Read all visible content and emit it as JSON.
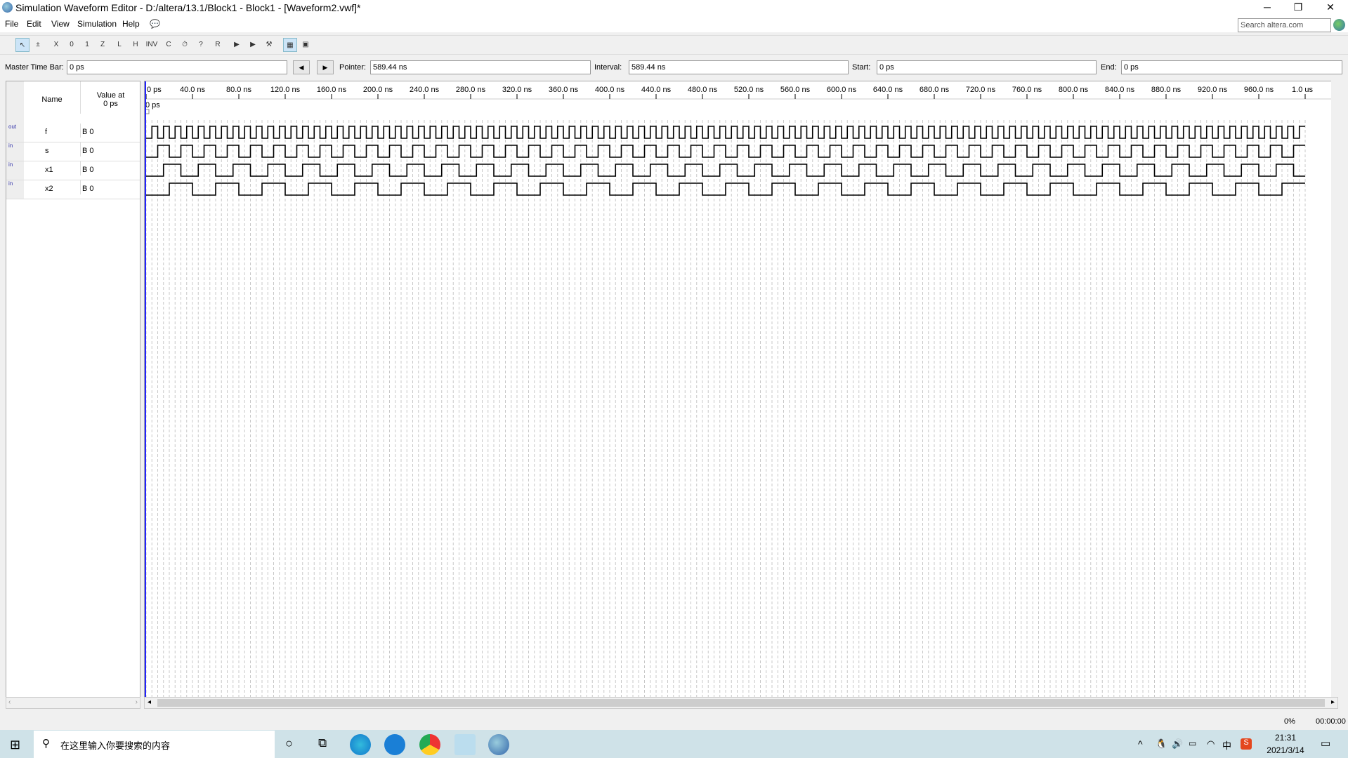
{
  "window": {
    "title": "Simulation Waveform Editor - D:/altera/13.1/Block1 - Block1 - [Waveform2.vwf]*",
    "minimize": "─",
    "restore": "❐",
    "close": "✕"
  },
  "menu": [
    "File",
    "Edit",
    "View",
    "Simulation",
    "Help"
  ],
  "search": {
    "placeholder": "Search altera.com"
  },
  "toolbar": [
    {
      "icon": "selection-tool-icon",
      "glyph": "↖"
    },
    {
      "icon": "zoom-tool-icon",
      "glyph": "±"
    },
    {
      "icon": "forcing-unknown-icon",
      "glyph": "X"
    },
    {
      "icon": "forcing-low-icon",
      "glyph": "0"
    },
    {
      "icon": "forcing-high-icon",
      "glyph": "1"
    },
    {
      "icon": "high-impedance-icon",
      "glyph": "Z"
    },
    {
      "icon": "weak-low-icon",
      "glyph": "L"
    },
    {
      "icon": "weak-high-icon",
      "glyph": "H"
    },
    {
      "icon": "invert-icon",
      "glyph": "INV"
    },
    {
      "icon": "count-value-icon",
      "glyph": "C"
    },
    {
      "icon": "overwrite-clock-icon",
      "glyph": "⏱"
    },
    {
      "icon": "arbitrary-value-icon",
      "glyph": "?"
    },
    {
      "icon": "random-value-icon",
      "glyph": "R"
    },
    {
      "icon": "functional-simulation-icon",
      "glyph": "▶"
    },
    {
      "icon": "timing-simulation-icon",
      "glyph": "▶"
    },
    {
      "icon": "netlist-writer-icon",
      "glyph": "⚒"
    },
    {
      "icon": "snap-to-grid-icon",
      "glyph": "▦"
    },
    {
      "icon": "grid-settings-icon",
      "glyph": "▣"
    }
  ],
  "fields": {
    "master_label": "Master Time Bar:",
    "master": "0 ps",
    "pointer_label": "Pointer:",
    "pointer": "589.44 ns",
    "interval_label": "Interval:",
    "interval": "589.44 ns",
    "start_label": "Start:",
    "start": "0 ps",
    "end_label": "End:",
    "end": "0 ps",
    "prev": "◀",
    "next": "▶"
  },
  "table": {
    "name_header": "Name",
    "value_header": "Value at\n0 ps"
  },
  "signals": [
    {
      "dir": "out",
      "name": "f",
      "value": "B 0"
    },
    {
      "dir": "in",
      "name": "s",
      "value": "B 0"
    },
    {
      "dir": "in",
      "name": "x1",
      "value": "B 0"
    },
    {
      "dir": "in",
      "name": "x2",
      "value": "B 0"
    }
  ],
  "chart_data": {
    "type": "timing",
    "x_unit": "ns",
    "xlim": [
      0,
      1000
    ],
    "grid_step_ns": 5,
    "tick_labels": [
      "0 ps",
      "40.0 ns",
      "80.0 ns",
      "120.0 ns",
      "160.0 ns",
      "200.0 ns",
      "240.0 ns",
      "280.0 ns",
      "320.0 ns",
      "360.0 ns",
      "400.0 ns",
      "440.0 ns",
      "480.0 ns",
      "520.0 ns",
      "560.0 ns",
      "600.0 ns",
      "640.0 ns",
      "680.0 ns",
      "720.0 ns",
      "760.0 ns",
      "800.0 ns",
      "840.0 ns",
      "880.0 ns",
      "920.0 ns",
      "960.0 ns",
      "1.0 us"
    ],
    "master_marker": "0 ps",
    "series": [
      {
        "name": "f",
        "initial": 0,
        "first_rise_ns": 5,
        "period_ns": 10
      },
      {
        "name": "s",
        "initial": 0,
        "first_rise_ns": 10,
        "period_ns": 20
      },
      {
        "name": "x1",
        "initial": 0,
        "first_rise_ns": 15,
        "period_ns": 30
      },
      {
        "name": "x2",
        "initial": 0,
        "first_rise_ns": 20,
        "period_ns": 40
      }
    ]
  },
  "status": {
    "percent": "0%",
    "time": "00:00:00"
  },
  "taskbar": {
    "search_placeholder": "在这里输入你要搜索的内容",
    "time": "21:31",
    "date": "2021/3/14",
    "ime": "中"
  }
}
